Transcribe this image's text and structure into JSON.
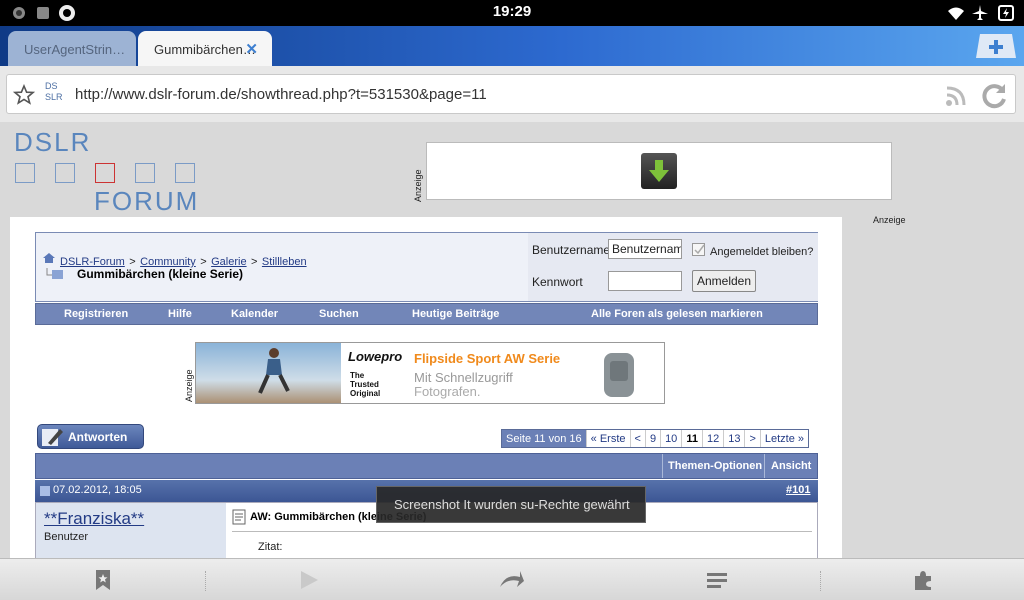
{
  "status": {
    "time": "19:29"
  },
  "tabs": [
    {
      "label": "UserAgentStrin…",
      "active": false
    },
    {
      "label": "Gummibärchen…",
      "active": true,
      "close": "✕"
    }
  ],
  "urlbar": {
    "url": "http://www.dslr-forum.de/showthread.php?t=531530&page=11",
    "favicon_lines": [
      "DS",
      "SLR"
    ]
  },
  "logo": {
    "top": "DSLR",
    "bottom": "FORUM"
  },
  "ads": {
    "top_label": "Anzeige",
    "side_label": "Anzeige",
    "banner_label": "Anzeige",
    "banner": {
      "brand": "Lowepro",
      "tagline": "The Trusted Original",
      "title": "Flipside Sport AW Serie",
      "sub1": "Mit Schnellzugriff",
      "sub2": "Fotografen."
    }
  },
  "breadcrumb": {
    "items": [
      "DSLR-Forum",
      "Community",
      "Galerie",
      "Stillleben"
    ],
    "sep": ">",
    "current": "Gummibärchen (kleine Serie)"
  },
  "login": {
    "username_label": "Benutzername",
    "username_value": "Benutzernam",
    "remember_label": "Angemeldet bleiben?",
    "password_label": "Kennwort",
    "login_button": "Anmelden"
  },
  "navbar": {
    "items": [
      "Registrieren",
      "Hilfe",
      "Kalender",
      "Suchen",
      "Heutige Beiträge",
      "Alle Foren als gelesen markieren"
    ]
  },
  "reply_button": "Antworten",
  "pagination": {
    "label": "Seite 11 von 16",
    "first": "« Erste",
    "prev": "<",
    "pages": [
      "9",
      "10",
      "11",
      "12",
      "13"
    ],
    "current": "11",
    "next": ">",
    "last": "Letzte »"
  },
  "thread_header": {
    "options": "Themen-Optionen",
    "view": "Ansicht"
  },
  "post": {
    "date": "07.02.2012, 18:05",
    "number": "#101",
    "user": "**Franziska**",
    "role": "Benutzer",
    "title": "AW: Gummibärchen (kleine Serie)",
    "quote_label": "Zitat:"
  },
  "toast": "Screenshot It wurden su-Rechte gewährt",
  "colors": {
    "forum_blue": "#6b80b6",
    "tab_active": "#f6f6f6",
    "toast_bg": "#282828"
  }
}
